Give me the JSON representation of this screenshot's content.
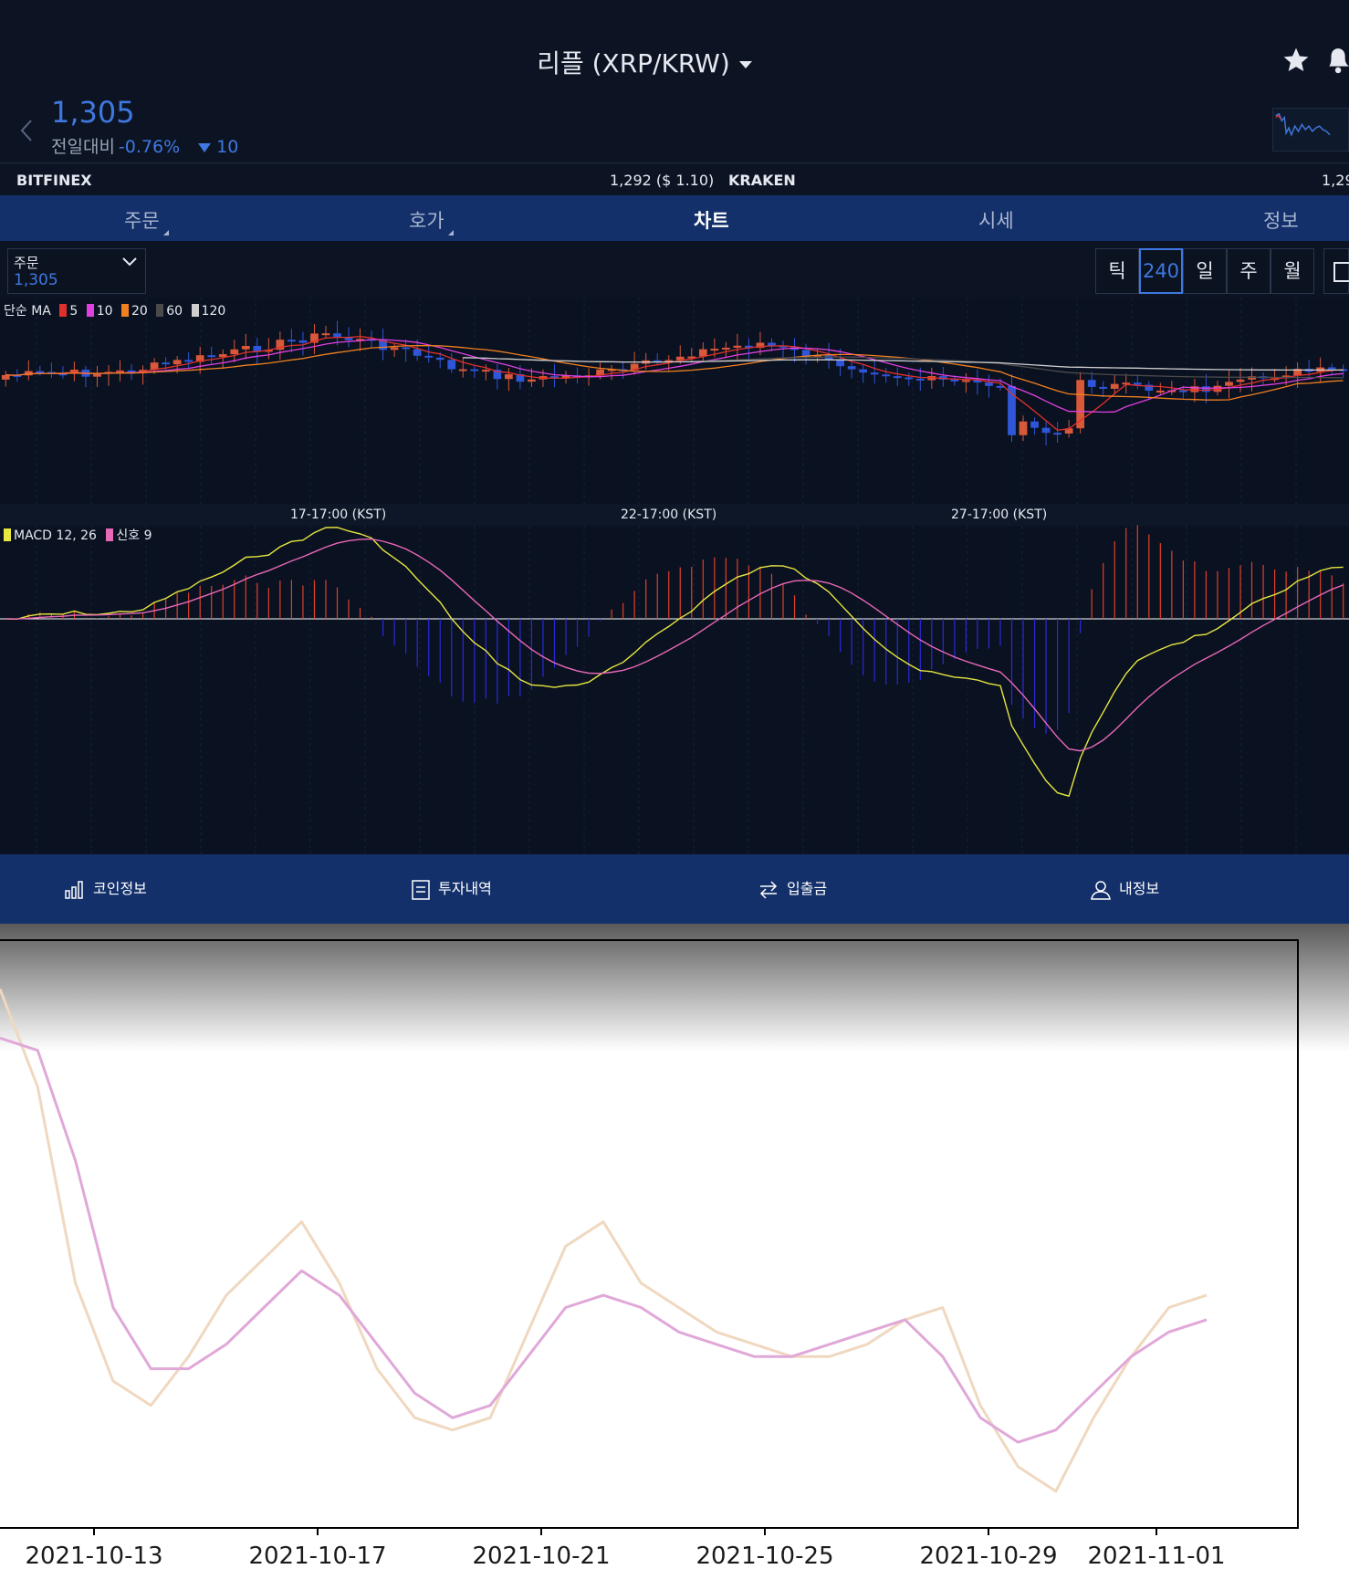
{
  "header": {
    "title": "리플 (XRP/KRW)"
  },
  "ticker": {
    "price": "1,305",
    "change_label": "전일대비",
    "change_pct": "-0.76%",
    "change_amt": "10"
  },
  "exchanges": {
    "left_name": "BITFINEX",
    "mid_value": "1,292 ($ 1.10)",
    "right_name": "KRAKEN",
    "right_value": "1,29"
  },
  "tabs": [
    "주문",
    "호가",
    "차트",
    "시세",
    "정보"
  ],
  "active_tab": "차트",
  "order_box": {
    "label": "주문",
    "value": "1,305"
  },
  "intervals": [
    "틱",
    "240",
    "일",
    "주",
    "월"
  ],
  "selected_interval": "240",
  "ma_legend": {
    "title": "단순 MA",
    "periods": [
      "5",
      "10",
      "20",
      "60",
      "120"
    ],
    "colors": [
      "#e0302c",
      "#e040e0",
      "#f08020",
      "#4a4a4a",
      "#cfcfcf"
    ]
  },
  "macd_legend": {
    "label": "MACD 12, 26",
    "signal": "신호 9",
    "colors": [
      "#e6e640",
      "#e868b8"
    ]
  },
  "time_labels": [
    "17-17:00 (KST)",
    "22-17:00 (KST)",
    "27-17:00 (KST)"
  ],
  "bottom_nav": [
    {
      "label": "코인정보",
      "icon": "bar-chart-icon"
    },
    {
      "label": "투자내역",
      "icon": "document-icon"
    },
    {
      "label": "입출금",
      "icon": "transfer-icon"
    },
    {
      "label": "내정보",
      "icon": "user-icon"
    }
  ],
  "colors": {
    "bg": "#0c1424",
    "bar": "#13306a",
    "accent": "#3f78e0",
    "up": "#e0502c",
    "down": "#2a50d8"
  },
  "chart_data": {
    "type": "line",
    "xlabel": "",
    "ylabel": "",
    "x_ticks": [
      "2021-10-13",
      "2021-10-17",
      "2021-10-21",
      "2021-10-25",
      "2021-10-29",
      "2021-11-01"
    ],
    "series": [
      {
        "color": "#f0d8c0",
        "values": [
          44,
          36,
          20,
          12,
          10,
          14,
          19,
          22,
          25,
          20,
          13,
          9,
          8,
          9,
          16,
          23,
          25,
          20,
          18,
          16,
          15,
          14,
          14,
          15,
          17,
          18,
          10,
          5,
          3,
          9,
          14,
          18,
          19
        ]
      },
      {
        "color": "#e0a8d8",
        "values": [
          40,
          39,
          30,
          18,
          13,
          13,
          15,
          18,
          21,
          19,
          15,
          11,
          9,
          10,
          14,
          18,
          19,
          18,
          16,
          15,
          14,
          14,
          15,
          16,
          17,
          14,
          9,
          7,
          8,
          11,
          14,
          16,
          17
        ]
      }
    ]
  }
}
